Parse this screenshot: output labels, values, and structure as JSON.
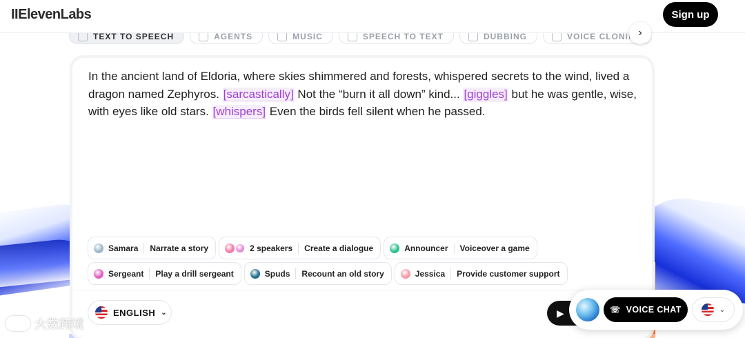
{
  "header": {
    "logo": "IIElevenLabs",
    "signup_label": "Sign up"
  },
  "tabs": [
    {
      "label": "TEXT TO SPEECH",
      "icon": "waveform-icon",
      "active": true
    },
    {
      "label": "AGENTS",
      "icon": "agent-icon"
    },
    {
      "label": "MUSIC",
      "icon": "music-icon"
    },
    {
      "label": "SPEECH TO TEXT",
      "icon": "transcript-icon"
    },
    {
      "label": "DUBBING",
      "icon": "dubbing-icon"
    },
    {
      "label": "VOICE CLONING",
      "icon": "clone-icon"
    }
  ],
  "editor": {
    "segments": [
      {
        "text": "In the ancient land of Eldoria, where skies shimmered and forests, whispered secrets to the wind, lived a dragon named Zephyros. ",
        "tag": false
      },
      {
        "text": "[sarcastically]",
        "tag": true
      },
      {
        "text": " Not the “burn it all down” kind... ",
        "tag": false
      },
      {
        "text": "[giggles]",
        "tag": true
      },
      {
        "text": " but he was gentle, wise, with eyes like old stars. ",
        "tag": false
      },
      {
        "text": "[whispers]",
        "tag": true
      },
      {
        "text": " Even the birds fell silent when he passed.",
        "tag": false
      }
    ]
  },
  "presets": [
    {
      "voice": "Samara",
      "action": "Narrate a story",
      "avatar": "#9bb7c9"
    },
    {
      "voice": "2 speakers",
      "action": "Create a dialogue",
      "avatar": "#f07aa8",
      "avatar2": "#e38bd6"
    },
    {
      "voice": "Announcer",
      "action": "Voiceover a game",
      "avatar": "#2bbf8a"
    },
    {
      "voice": "Sergeant",
      "action": "Play a drill sergeant",
      "avatar": "#e05dc3"
    },
    {
      "voice": "Spuds",
      "action": "Recount an old story",
      "avatar": "#1f6f8f"
    },
    {
      "voice": "Jessica",
      "action": "Provide customer support",
      "avatar": "#f49aa8"
    }
  ],
  "language": {
    "label": "ENGLISH"
  },
  "voice_chat": {
    "label": "VOICE CHAT"
  },
  "watermark": {
    "text": "大数跨境"
  },
  "colors": {
    "accent_tag": "#a03fd9",
    "primary": "#000000"
  }
}
